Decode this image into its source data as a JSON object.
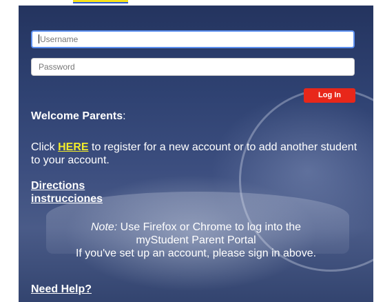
{
  "login": {
    "username_placeholder": "Username",
    "password_placeholder": "Password",
    "login_label": "Log In"
  },
  "welcome": {
    "heading": "Welcome Parents",
    "colon": ":"
  },
  "register": {
    "pre": "Click ",
    "link": "HERE",
    "post": " to register for a new account or to add another student to your account."
  },
  "links": {
    "directions": "Directions",
    "instrucciones": "instrucciones"
  },
  "note": {
    "label": "Note:",
    "line1": " Use Firefox or Chrome to log into the",
    "line2": "myStudent Parent Portal",
    "line3": "If you've set up an account, please sign in above."
  },
  "help": {
    "label": "Need Help?"
  }
}
